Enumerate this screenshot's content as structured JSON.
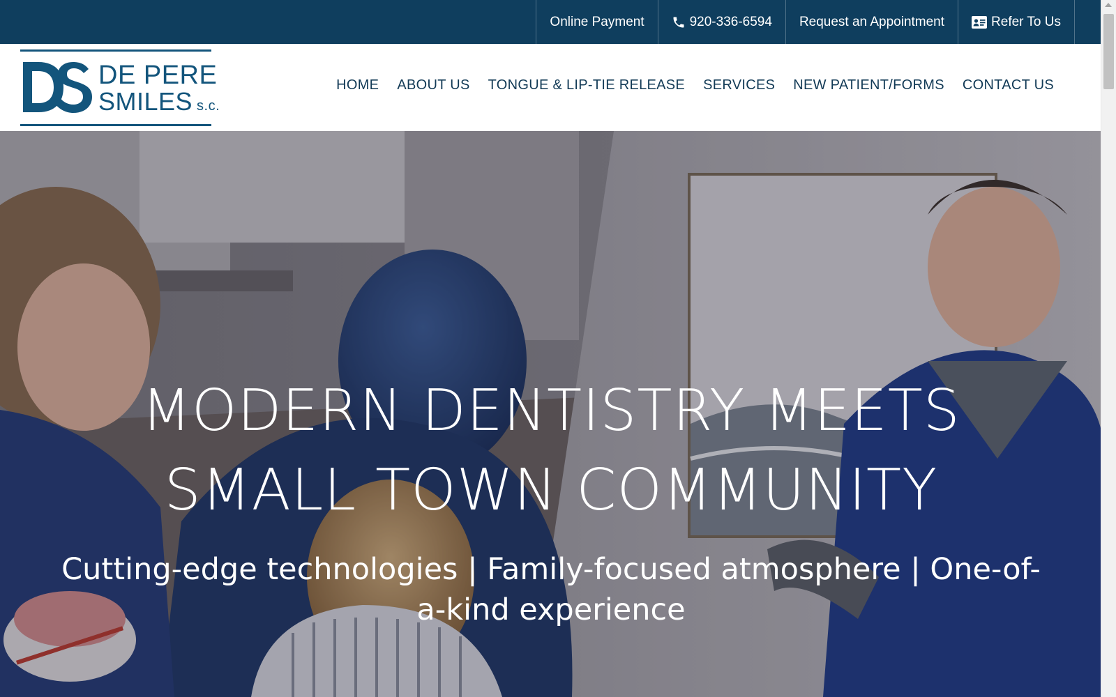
{
  "topbar": {
    "links": [
      {
        "label": "Online Payment",
        "icon": null
      },
      {
        "label": "920-336-6594",
        "icon": "phone-icon"
      },
      {
        "label": "Request an Appointment",
        "icon": null
      },
      {
        "label": "Refer To Us",
        "icon": "id-card-icon"
      }
    ]
  },
  "logo": {
    "mark": "DS",
    "line1": "DE PERE",
    "line2": "SMILES",
    "suffix": "s.c."
  },
  "nav": {
    "items": [
      "HOME",
      "ABOUT US",
      "TONGUE & LIP-TIE RELEASE",
      "SERVICES",
      "NEW PATIENT/FORMS",
      "CONTACT US"
    ]
  },
  "hero": {
    "title": "MODERN DENTISTRY MEETS SMALL TOWN COMMUNITY",
    "subtitle": "Cutting-edge technologies | Family-focused atmosphere | One-of-a-kind experience"
  },
  "colors": {
    "topbar": "#0f3e5e",
    "brand": "#13557c",
    "nav_text": "#123a56"
  }
}
